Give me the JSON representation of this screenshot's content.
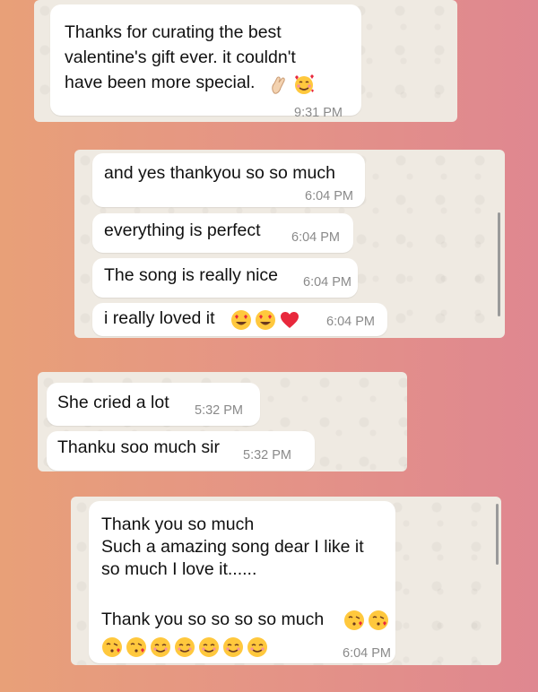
{
  "panels": [
    {
      "messages": [
        {
          "lines": [
            "Thanks for curating the best",
            "valentine's gift ever. it couldn't",
            "have been more special."
          ],
          "time": "9:31 PM",
          "emojis": [
            "pinched-fingers",
            "smiling-face-with-hearts"
          ]
        }
      ]
    },
    {
      "messages": [
        {
          "text": "and yes thankyou so so much",
          "time": "6:04 PM"
        },
        {
          "text": "everything is perfect",
          "time": "6:04 PM"
        },
        {
          "text": "The song is really nice",
          "time": "6:04 PM"
        },
        {
          "text": "i really loved it",
          "time": "6:04 PM",
          "emojis": [
            "heart-eyes",
            "heart-eyes",
            "red-heart"
          ]
        }
      ]
    },
    {
      "messages": [
        {
          "text": "She cried a lot",
          "time": "5:32 PM"
        },
        {
          "text": "Thanku soo much sir",
          "time": "5:32 PM"
        }
      ]
    },
    {
      "messages": [
        {
          "lines": [
            "Thank you so much",
            "Such a amazing song dear I like it",
            "so much I love it......",
            "",
            "Thank you so so so so much"
          ],
          "time": "6:04 PM",
          "emojis_inline": [
            "face-blowing-kiss",
            "face-blowing-kiss"
          ],
          "emojis_row": [
            "face-blowing-kiss",
            "face-blowing-kiss",
            "smiling-face",
            "smiling-face",
            "smiling-face",
            "smiling-face",
            "smiling-face"
          ]
        }
      ]
    }
  ],
  "colors": {
    "background_left": "#e8a078",
    "background_right": "#df8790",
    "panel": "#efeae2",
    "bubble": "#ffffff",
    "timestamp": "#8a8a8a"
  }
}
